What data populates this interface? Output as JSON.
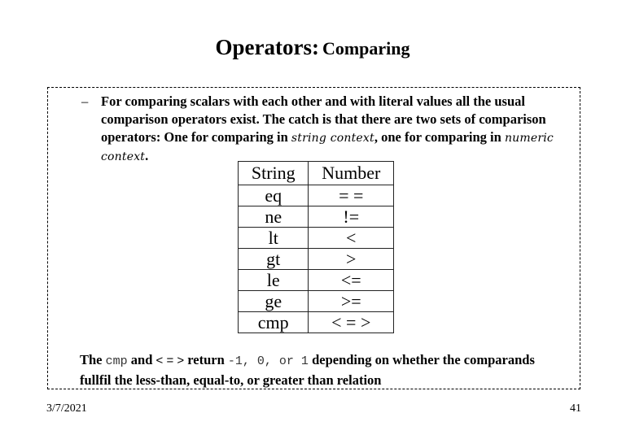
{
  "slide": {
    "title_main": "Operators:",
    "title_sub": "Comparing",
    "bullet": {
      "marker": "–",
      "text_1": "For comparing scalars with each other and with literal values all the usual comparison operators exist. The catch is that there are two sets of comparison operators: One for comparing in ",
      "em_1": "string context",
      "text_2": ", one for comparing in ",
      "em_2": "numeric context",
      "text_3": "."
    },
    "table": {
      "headers": [
        "String",
        "Number"
      ],
      "rows": [
        [
          "eq",
          "= ="
        ],
        [
          "ne",
          "!="
        ],
        [
          "lt",
          "<"
        ],
        [
          "gt",
          ">"
        ],
        [
          "le",
          "<="
        ],
        [
          "ge",
          ">="
        ],
        [
          "cmp",
          "< = >"
        ]
      ]
    },
    "note": {
      "p1": "The ",
      "code_1": "cmp",
      "p2": "  and ",
      "code_2": "< = >",
      "p3": " return ",
      "code_3": "-1, 0, or 1",
      "p4": " depending on whether the comparands fullfil the less-than, equal-to, or greater than relation"
    },
    "footer": {
      "date": "3/7/2021",
      "page": "41"
    }
  }
}
